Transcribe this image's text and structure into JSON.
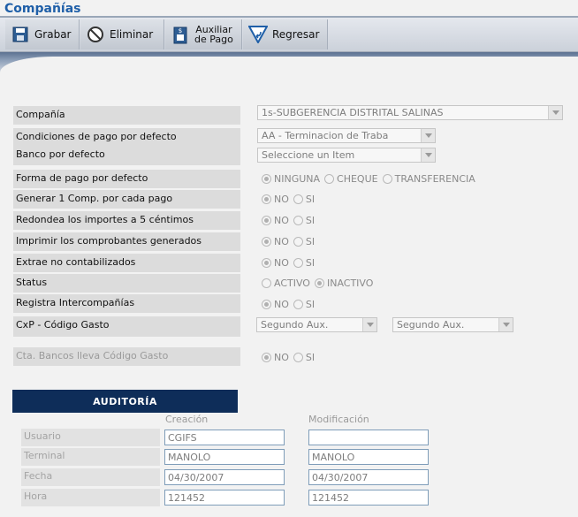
{
  "window": {
    "title": "Compañías"
  },
  "toolbar": {
    "save_label": "Grabar",
    "delete_label": "Eliminar",
    "aux_line1": "Auxiliar",
    "aux_line2": "de Pago",
    "back_label": "Regresar"
  },
  "form": {
    "company": {
      "label": "Compañía",
      "value": "1s-SUBGERENCIA DISTRITAL SALINAS"
    },
    "payment_conditions": {
      "label": "Condiciones de pago por defecto",
      "value": "AA - Terminacion de Traba"
    },
    "bank": {
      "label": "Banco por defecto",
      "value": "Seleccione un Item"
    },
    "payment_method": {
      "label": "Forma de pago por defecto",
      "options": [
        "NINGUNA",
        "CHEQUE",
        "TRANSFERENCIA"
      ],
      "selected": "NINGUNA"
    },
    "one_voucher": {
      "label": "Generar 1 Comp. por cada pago",
      "options": [
        "NO",
        "SI"
      ],
      "selected": "NO"
    },
    "round_amounts": {
      "label": "Redondea los importes a 5 céntimos",
      "options": [
        "NO",
        "SI"
      ],
      "selected": "NO"
    },
    "print_vouchers": {
      "label": "Imprimir los comprobantes generados",
      "options": [
        "NO",
        "SI"
      ],
      "selected": "NO"
    },
    "extract_uncounted": {
      "label": "Extrae no contabilizados",
      "options": [
        "NO",
        "SI"
      ],
      "selected": "NO"
    },
    "status": {
      "label": "Status",
      "options": [
        "ACTIVO",
        "INACTIVO"
      ],
      "selected": "INACTIVO"
    },
    "intercompany": {
      "label": "Registra Intercompañías",
      "options": [
        "NO",
        "SI"
      ],
      "selected": "NO"
    },
    "cxp_code": {
      "label": "CxP - Código Gasto",
      "value1": "Segundo Aux.",
      "value2": "Segundo Aux."
    },
    "bank_account_code": {
      "label": "Cta. Bancos lleva Código Gasto",
      "options": [
        "NO",
        "SI"
      ],
      "selected": "NO"
    }
  },
  "audit": {
    "header": "AUDITORÍA",
    "col_creation": "Creación",
    "col_modification": "Modificación",
    "rows": [
      {
        "label": "Usuario",
        "creation": "CGIFS",
        "modification": ""
      },
      {
        "label": "Terminal",
        "creation": "MANOLO",
        "modification": "MANOLO"
      },
      {
        "label": "Fecha",
        "creation": "04/30/2007",
        "modification": "04/30/2007"
      },
      {
        "label": "Hora",
        "creation": "121452",
        "modification": "121452"
      }
    ]
  }
}
